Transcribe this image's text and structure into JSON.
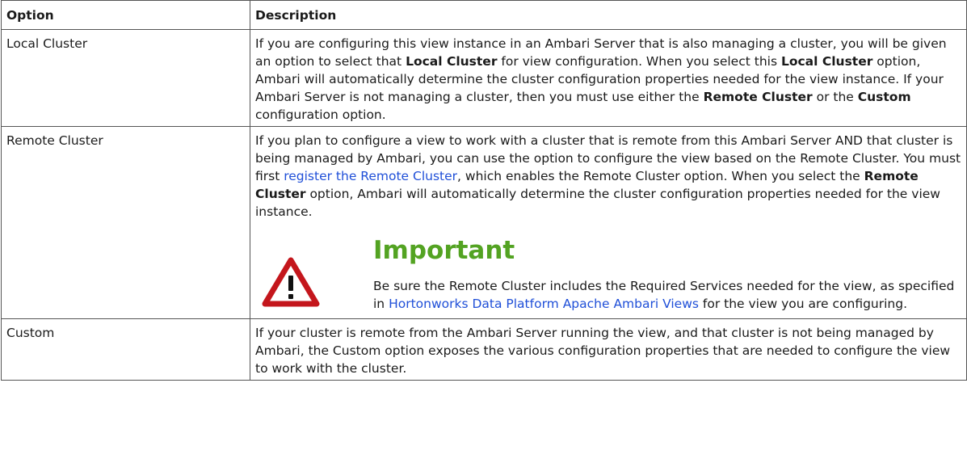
{
  "table": {
    "headers": [
      "Option",
      "Description"
    ],
    "rows": [
      {
        "option": "Local Cluster",
        "description": {
          "t1": "If you are configuring this view instance in an Ambari Server that is also managing a cluster, you will be given an option to select that ",
          "b1": "Local Cluster",
          "t2": " for view configuration. When you select this ",
          "b2": "Local Cluster",
          "t3": " option, Ambari will automatically determine the cluster configuration properties needed for the view instance. If your Ambari Server is not managing a cluster, then you must use either the ",
          "b3": "Remote Cluster",
          "t4": " or the ",
          "b4": "Custom",
          "t5": " configuration option."
        }
      },
      {
        "option": "Remote Cluster",
        "description": {
          "t1": "If you plan to configure a view to work with a cluster that is remote from this Ambari Server AND that cluster is being managed by Ambari, you can use the option to configure the view based on the Remote Cluster. You must first ",
          "link1": "register the Remote Cluster",
          "t2": ", which enables the Remote Cluster option. When you select the ",
          "b1": "Remote Cluster",
          "t3": " option, Ambari will automatically determine the cluster configuration properties needed for the view instance."
        },
        "admonition": {
          "title": "Important",
          "icon": "warning-triangle-icon",
          "t1": "Be sure the Remote Cluster includes the Required Services needed for the view, as specified in ",
          "link1": "Hortonworks Data Platform Apache Ambari Views",
          "t2": " for the view you are configuring."
        }
      },
      {
        "option": "Custom",
        "description": {
          "t1": "If your cluster is remote from the Ambari Server running the view, and that cluster is not being managed by Ambari, the Custom option exposes the various configuration properties that are needed to configure the view to work with the cluster."
        }
      }
    ]
  },
  "colors": {
    "link": "#1f4fd8",
    "important_title": "#53a322",
    "warning_icon": "#c4161c",
    "border": "#555555"
  }
}
